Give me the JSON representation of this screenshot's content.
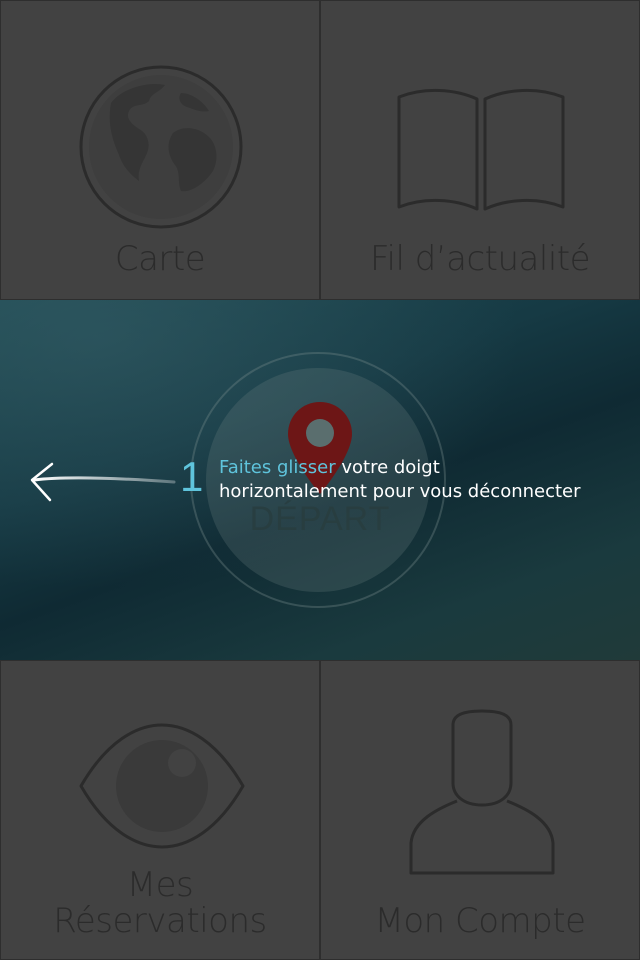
{
  "tiles": {
    "carte": {
      "label": "Carte",
      "icon": "globe-icon"
    },
    "fil": {
      "label": "Fil d’actualité",
      "icon": "open-book-icon"
    },
    "reservations": {
      "label_line1": "Mes",
      "label_line2": "Réservations",
      "icon": "eye-icon"
    },
    "compte": {
      "label": "Mon Compte",
      "icon": "user-icon"
    }
  },
  "center": {
    "depart_label": "DÉPART",
    "pin_icon": "map-pin-icon",
    "arrow_icon": "swipe-left-arrow-icon"
  },
  "hint": {
    "number": "1",
    "highlight": "Faites glisser",
    "line1_rest": " votre doigt",
    "line2": "horizontalement pour vous déconnecter"
  },
  "colors": {
    "tile_bg": "#424242",
    "tile_border": "#2e2e2e",
    "icon_stroke": "#2b2b2b",
    "accent": "#5fc4dc",
    "pin": "#7a1a1a",
    "panel_dark": "#0f2a33"
  }
}
